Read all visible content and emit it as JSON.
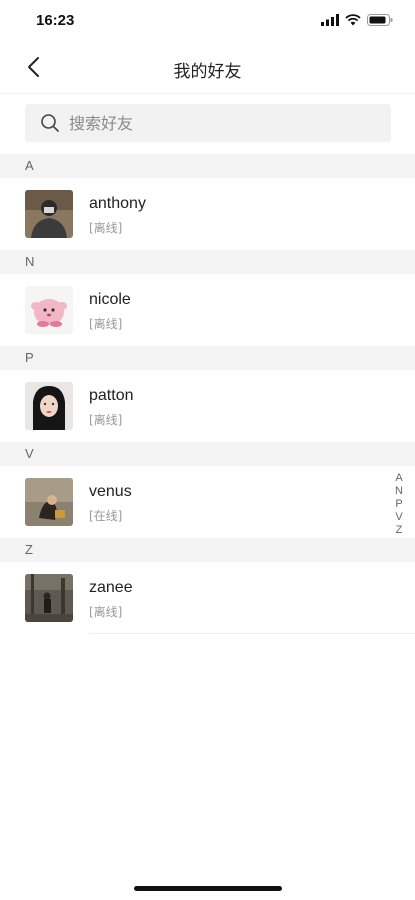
{
  "status_bar": {
    "time": "16:23",
    "icons": [
      "signal-icon",
      "wifi-icon",
      "battery-icon"
    ]
  },
  "nav": {
    "title": "我的好友",
    "back_icon": "chevron-left-icon"
  },
  "search": {
    "placeholder": "搜索好友",
    "value": "",
    "icon": "search-icon"
  },
  "sections": [
    {
      "letter": "A",
      "friends": [
        {
          "name": "anthony",
          "status": "[离线]"
        }
      ]
    },
    {
      "letter": "N",
      "friends": [
        {
          "name": "nicole",
          "status": "[离线]"
        }
      ]
    },
    {
      "letter": "P",
      "friends": [
        {
          "name": "patton",
          "status": "[离线]"
        }
      ]
    },
    {
      "letter": "V",
      "friends": [
        {
          "name": "venus",
          "status": "[在线]"
        }
      ]
    },
    {
      "letter": "Z",
      "friends": [
        {
          "name": "zanee",
          "status": "[离线]"
        }
      ]
    }
  ],
  "index_bar": [
    "A",
    "N",
    "P",
    "V",
    "Z"
  ],
  "colors": {
    "section_bg": "#f3f3f3",
    "search_bg": "#f2f2f2",
    "status_text": "#999999"
  }
}
